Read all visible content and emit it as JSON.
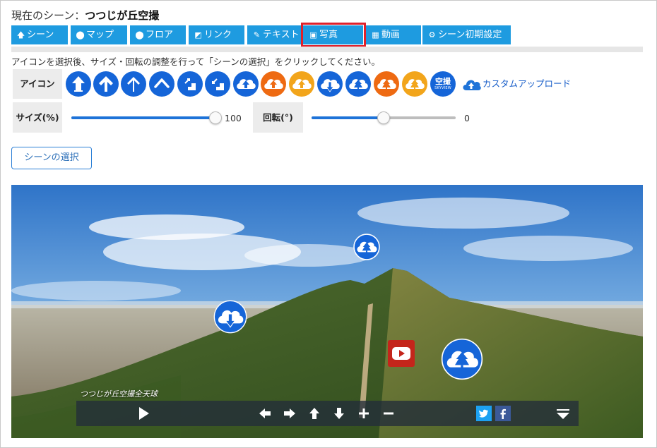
{
  "header": {
    "scene_prefix": "現在のシーン：",
    "scene_name": "つつじが丘空撮"
  },
  "tabs": [
    {
      "label": "シーン",
      "icon": "arrow-up-icon"
    },
    {
      "label": "マップ",
      "icon": "map-pin-icon"
    },
    {
      "label": "フロア",
      "icon": "map-pin-icon"
    },
    {
      "label": "リンク",
      "icon": "link-square-icon"
    },
    {
      "label": "テキスト",
      "icon": "edit-icon"
    },
    {
      "label": "写真",
      "icon": "image-icon",
      "active": true
    },
    {
      "label": "動画",
      "icon": "film-icon"
    },
    {
      "label": "シーン初期設定",
      "icon": "gear-icon"
    }
  ],
  "instructions": "アイコンを選択後、サイズ・回転の調整を行って「シーンの選択」をクリックしてください。",
  "icon_row": {
    "label": "アイコン",
    "icons": [
      "arrow-up-house-icon",
      "arrow-up-icon",
      "arrow-up-thin-icon",
      "chevron-up-icon",
      "stairs-up-icon",
      "stairs-down-icon",
      "cloud-upload-icon",
      "cloud-upload-orange-icon",
      "cloud-upload-yellow-icon",
      "cloud-download-icon",
      "cloud-tree-icon",
      "cloud-tree-orange-icon",
      "cloud-tree-yellow-icon",
      "skyview-icon"
    ],
    "skyview_text": "空撮",
    "skyview_subtext": "SKYVIEW",
    "custom_upload": "カスタムアップロード"
  },
  "size": {
    "label": "サイズ(%)",
    "value": "100",
    "level": 1.0
  },
  "rotation": {
    "label": "回転(°)",
    "value": "0",
    "level": 0.5
  },
  "select_button": "シーンの選択",
  "panorama": {
    "caption": "つつじが丘空撮全天球",
    "hotspots": [
      "cloud-tree-icon",
      "cloud-download-icon",
      "youtube-icon",
      "cloud-tree-icon"
    ]
  },
  "controls": [
    "play-icon",
    "arrow-left-icon",
    "arrow-right-icon",
    "arrow-up-icon",
    "arrow-down-icon",
    "plus-icon",
    "minus-icon",
    "twitter-icon",
    "facebook-icon",
    "collapse-icon"
  ],
  "colors": {
    "accent": "#1e9be0",
    "icon_blue": "#1565d8",
    "icon_orange": "#ee6a12",
    "icon_yellow": "#f2a51b",
    "highlight": "#e0202a"
  }
}
